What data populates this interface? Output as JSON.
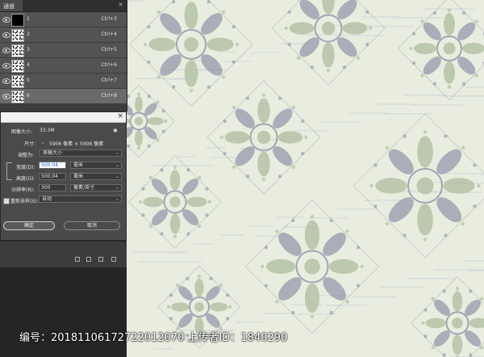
{
  "channels_panel": {
    "title": "通道",
    "close": "×",
    "rows": [
      {
        "name": "1",
        "shortcut": "Ctrl+3"
      },
      {
        "name": "2",
        "shortcut": "Ctrl+4"
      },
      {
        "name": "3",
        "shortcut": "Ctrl+5"
      },
      {
        "name": "4",
        "shortcut": "Ctrl+6"
      },
      {
        "name": "5",
        "shortcut": "Ctrl+7"
      },
      {
        "name": "6",
        "shortcut": "Ctrl+8"
      }
    ]
  },
  "image_size": {
    "close": "×",
    "image_size_label": "图像大小:",
    "image_size_value": "33.3M",
    "dimensions_label": "尺寸:",
    "dimensions_value": "5906 像素 × 5906 像素",
    "fit_label": "调整为:",
    "fit_value": "原稿大小",
    "width_label": "宽度(D):",
    "width_value": "500.04",
    "width_unit": "毫米",
    "height_label": "高度(G):",
    "height_value": "500.04",
    "height_unit": "毫米",
    "resolution_label": "分辨率(R):",
    "resolution_value": "300",
    "resolution_unit": "像素/英寸",
    "resample_label": "重新采样(S):",
    "resample_value": "自动",
    "ok_label": "确定",
    "cancel_label": "取消"
  },
  "watermark": {
    "text": "编号：20181106172722012070 上传者ID：1840290"
  },
  "colors": {
    "canvas_bg": "#e9eddf",
    "motif_gray": "#8e93a6",
    "motif_green": "#a9b99a",
    "panel_bg": "#3c3c3c",
    "highlight_blue": "#1e5fd6"
  },
  "icons": [
    "eye-icon",
    "gear-icon",
    "link-icon",
    "close-icon",
    "chevron-down-icon",
    "checkbox-icon"
  ]
}
